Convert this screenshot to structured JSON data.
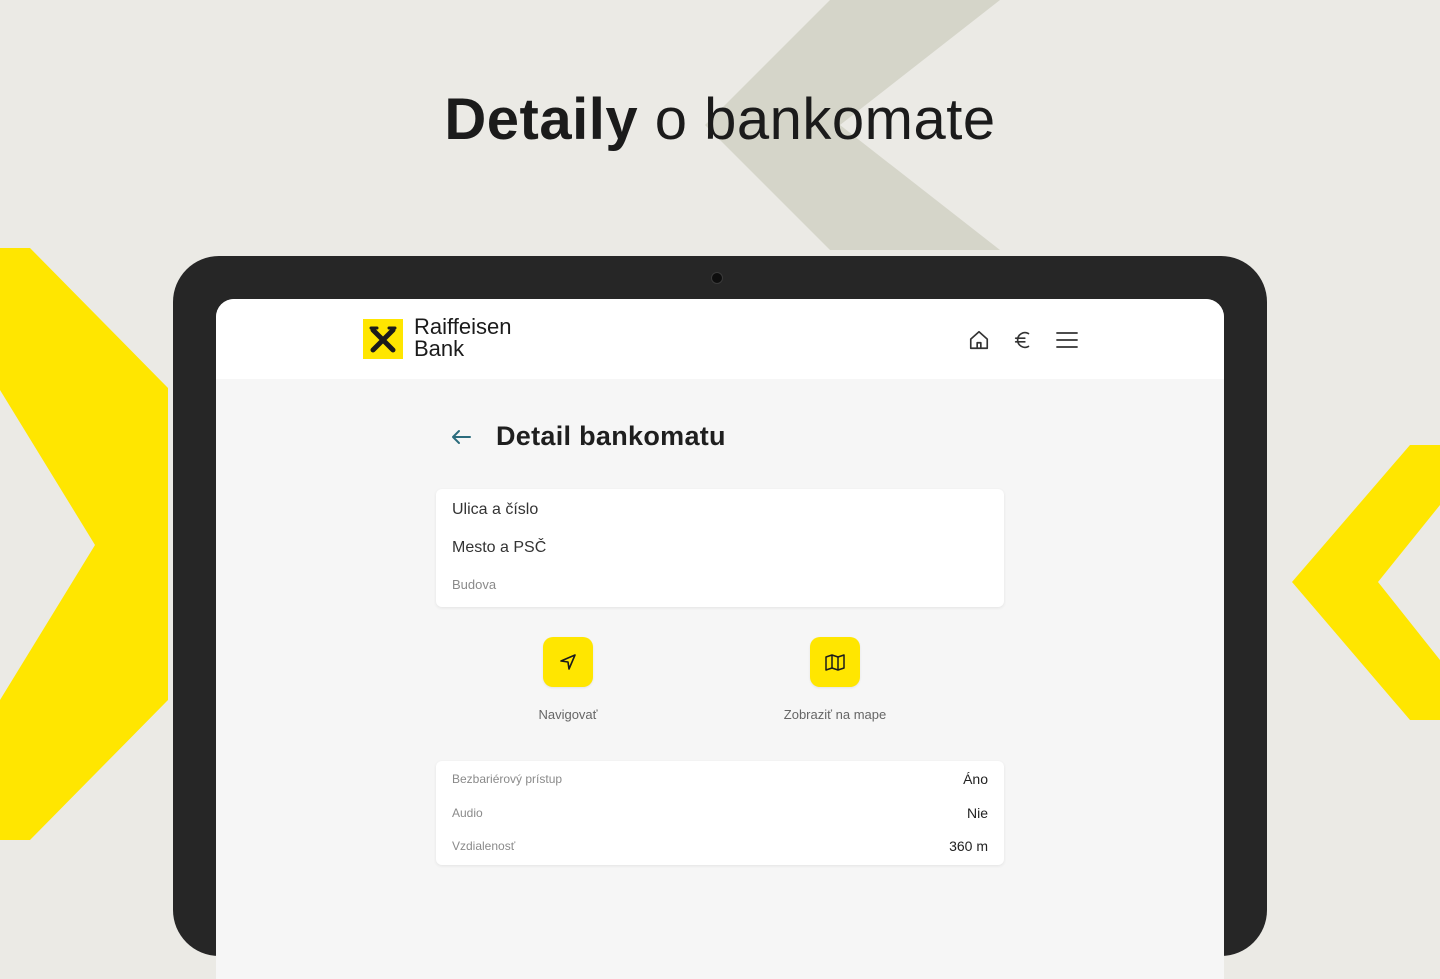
{
  "headline": {
    "bold": "Detaily",
    "light": "o bankomate"
  },
  "brand": {
    "line1": "Raiffeisen",
    "line2": "Bank",
    "accent": "#ffe600"
  },
  "header_icons": [
    "home-icon",
    "euro-icon",
    "menu-icon"
  ],
  "page": {
    "title": "Detail bankomatu"
  },
  "address": {
    "street": "Ulica a číslo",
    "city": "Mesto a PSČ",
    "building": "Budova"
  },
  "actions": {
    "navigate": {
      "label": "Navigovať",
      "icon": "navigation-arrow-icon"
    },
    "map": {
      "label": "Zobraziť na mape",
      "icon": "map-icon"
    }
  },
  "details": [
    {
      "label": "Bezbariérový prístup",
      "value": "Áno"
    },
    {
      "label": "Audio",
      "value": "Nie"
    },
    {
      "label": "Vzdialenosť",
      "value": "360 m"
    }
  ],
  "colors": {
    "background": "#ebeae5",
    "yellow": "#ffe600",
    "tablet_frame": "#262626"
  }
}
